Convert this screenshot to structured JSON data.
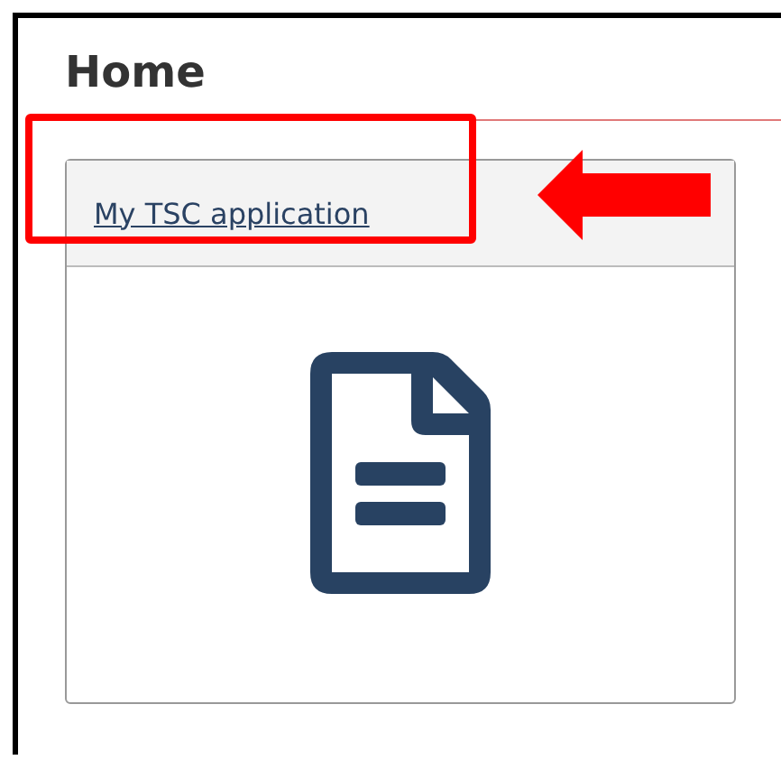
{
  "page": {
    "title": "Home"
  },
  "card": {
    "link": "My TSC application"
  }
}
